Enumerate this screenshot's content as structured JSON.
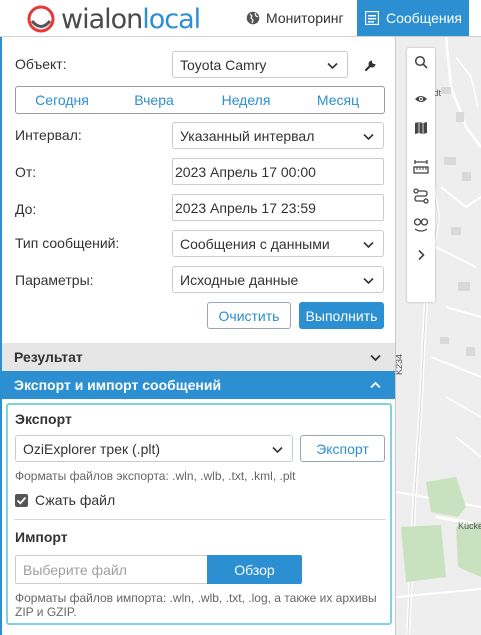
{
  "header": {
    "logo_text_1": "wialon",
    "logo_text_2": "local",
    "nav_monitoring": "Мониторинг",
    "nav_messages": "Сообщения"
  },
  "form": {
    "object_label": "Объект:",
    "object_value": "Toyota Camry",
    "tabs": [
      "Сегодня",
      "Вчера",
      "Неделя",
      "Месяц"
    ],
    "interval_label": "Интервал:",
    "interval_value": "Указанный интервал",
    "from_label": "От:",
    "from_value": "2023 Апрель 17 00:00",
    "to_label": "До:",
    "to_value": "2023 Апрель 17 23:59",
    "msgtype_label": "Тип сообщений:",
    "msgtype_value": "Сообщения с данными",
    "params_label": "Параметры:",
    "params_value": "Исходные данные",
    "clear_button": "Очистить",
    "run_button": "Выполнить"
  },
  "sections": {
    "result": "Результат",
    "export_import": "Экспорт и импорт сообщений"
  },
  "export": {
    "title": "Экспорт",
    "format_value": "OziExplorer трек (.plt)",
    "export_button": "Экспорт",
    "formats_hint": "Форматы файлов экспорта: .wln, .wlb, .txt, .kml, .plt",
    "compress_label": "Сжать файл",
    "compress_checked": true
  },
  "import": {
    "title": "Импорт",
    "file_placeholder": "Выберите файл",
    "browse_button": "Обзор",
    "formats_hint_line1": "Форматы файлов импорта: .wln, .wlb, .txt, .log, а также их архивы",
    "formats_hint_line2": "ZIP и GZIP."
  },
  "map": {
    "label_top": "tedt",
    "label_road": "K234",
    "label_street": "Kücke"
  },
  "colors": {
    "accent": "#2b8fd1",
    "export_border": "#7fd4dc",
    "result_bg": "#e6e6e6"
  },
  "icons": [
    "globe-icon",
    "messages-icon",
    "wrench-icon",
    "chevron-down-icon",
    "chevron-up-icon",
    "check-icon",
    "search-icon",
    "eye-icon",
    "map-icon",
    "ruler-icon",
    "route-icon",
    "geofence-icon",
    "chevron-right-icon"
  ]
}
